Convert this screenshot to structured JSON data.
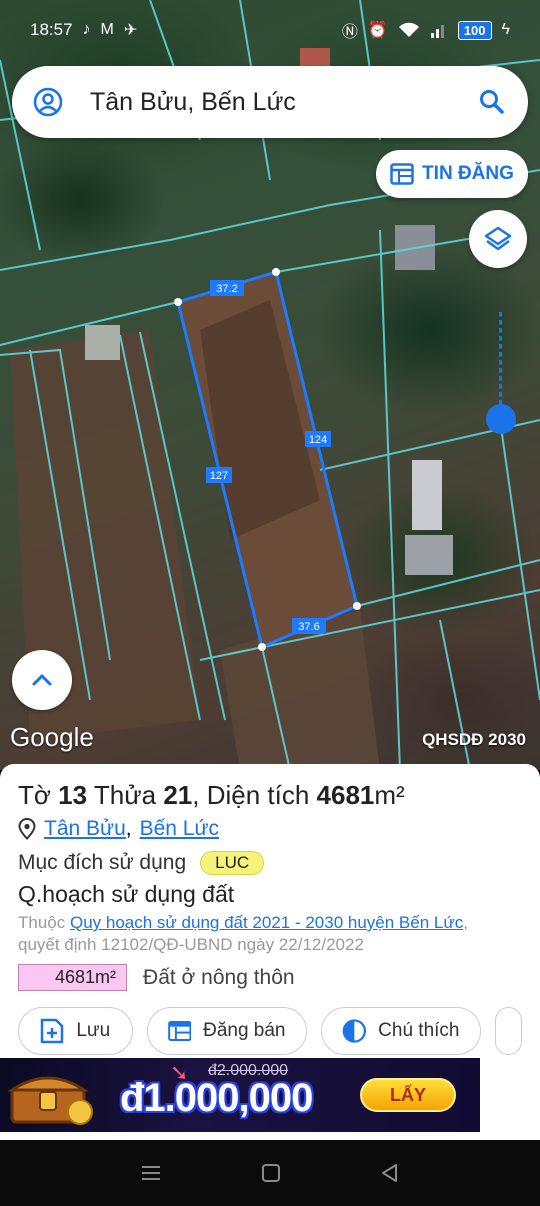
{
  "status_bar": {
    "time": "18:57",
    "battery": "100",
    "left_icons": [
      "tiktok-icon",
      "gmail-icon",
      "app-icon"
    ],
    "right_icons": [
      "nfc-icon",
      "alarm-icon",
      "wifi-icon",
      "signal-icon",
      "charging-icon"
    ]
  },
  "search": {
    "title": "Tân Bửu, Bến Lức"
  },
  "map": {
    "tin_dang_label": "TIN ĐĂNG",
    "google_label": "Google",
    "plan_label": "QHSDĐ 2030",
    "edge_labels": {
      "top": "37.2",
      "right": "124",
      "left": "127",
      "bottom": "37.6"
    },
    "parcel_color": "#1e7bff"
  },
  "parcel": {
    "to_label": "Tờ",
    "to_value": "13",
    "thua_label": "Thửa",
    "thua_value": "21",
    "area_label": "Diện tích",
    "area_value": "4681",
    "area_unit": "m²",
    "commune": "Tân Bửu",
    "district": "Bến Lức",
    "purpose_label": "Mục đích sử dụng",
    "purpose_code": "LUC",
    "plan_heading": "Q.hoạch sử dụng đất",
    "belongs_prefix": "Thuộc",
    "plan_link": "Quy hoạch sử dụng đất 2021 - 2030 huyện Bến Lức",
    "decision": "quyết định 12102/QĐ-UBND ngày 22/12/2022",
    "zone_area": "4681m²",
    "zone_desc": "Đất ở nông thôn"
  },
  "actions": {
    "save": "Lưu",
    "sell": "Đăng bán",
    "legend": "Chú thích"
  },
  "ad": {
    "old_price": "đ2.000.000",
    "new_price": "đ1.000,000",
    "claim": "LẤY"
  },
  "colors": {
    "accent": "#1a73e8",
    "luc_badge": "#f6f37a",
    "zone_badge": "#fbc6f2"
  }
}
